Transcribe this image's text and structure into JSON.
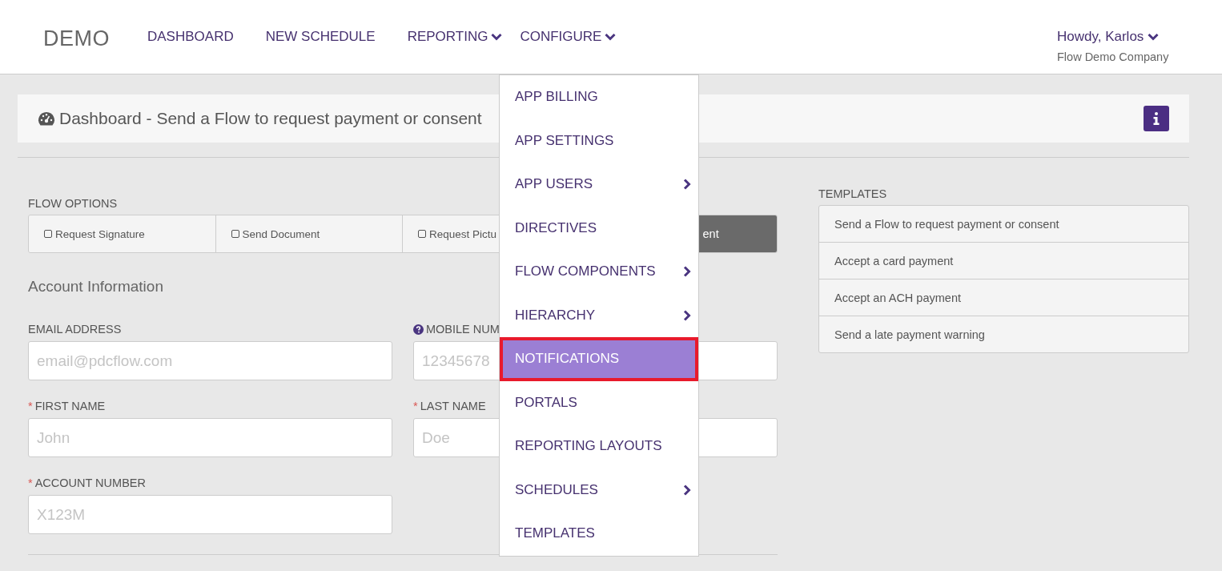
{
  "header": {
    "logo": "DEMO",
    "nav": [
      {
        "label": "DASHBOARD",
        "dropdown": false
      },
      {
        "label": "NEW SCHEDULE",
        "dropdown": false
      },
      {
        "label": "REPORTING",
        "dropdown": true
      },
      {
        "label": "CONFIGURE",
        "dropdown": true
      }
    ],
    "user": {
      "greeting": "Howdy, Karlos",
      "company": "Flow Demo Company"
    }
  },
  "page_title": "Dashboard - Send a Flow to request payment or consent",
  "flow_options": {
    "label": "FLOW OPTIONS",
    "options": [
      {
        "kind": "checkbox",
        "label": "Request Signature",
        "checked": false
      },
      {
        "kind": "checkbox",
        "label": "Send Document",
        "checked": false
      },
      {
        "kind": "checkbox",
        "label": "Request Pictu",
        "checked": false
      },
      {
        "kind": "button",
        "label": "ent"
      }
    ]
  },
  "account_information": {
    "heading": "Account Information",
    "fields": [
      {
        "label": "EMAIL ADDRESS",
        "placeholder": "email@pdcflow.com",
        "help": false
      },
      {
        "label": "MOBILE NUM",
        "placeholder": "12345678",
        "help": true
      },
      {
        "marker": "*",
        "label": "FIRST NAME",
        "placeholder": "John",
        "help": false
      },
      {
        "marker": "*",
        "label": "LAST NAME",
        "placeholder": "Doe",
        "help": false
      },
      {
        "marker": "*",
        "label": "ACCOUNT NUMBER",
        "placeholder": "X123M",
        "help": false
      }
    ]
  },
  "templates": {
    "label": "TEMPLATES",
    "items": [
      "Send a Flow to request payment or consent",
      "Accept a card payment",
      "Accept an ACH payment",
      "Send a late payment warning"
    ]
  },
  "configure_menu": {
    "items": [
      {
        "label": "APP BILLING",
        "submenu": false,
        "selected": false
      },
      {
        "label": "APP SETTINGS",
        "submenu": false,
        "selected": false
      },
      {
        "label": "APP USERS",
        "submenu": true,
        "selected": false
      },
      {
        "label": "DIRECTIVES",
        "submenu": false,
        "selected": false
      },
      {
        "label": "FLOW COMPONENTS",
        "submenu": true,
        "selected": false
      },
      {
        "label": "HIERARCHY",
        "submenu": true,
        "selected": false
      },
      {
        "label": "NOTIFICATIONS",
        "submenu": false,
        "selected": true
      },
      {
        "label": "PORTALS",
        "submenu": false,
        "selected": false
      },
      {
        "label": "REPORTING LAYOUTS",
        "submenu": false,
        "selected": false
      },
      {
        "label": "SCHEDULES",
        "submenu": true,
        "selected": false
      },
      {
        "label": "TEMPLATES",
        "submenu": false,
        "selected": false
      }
    ]
  }
}
